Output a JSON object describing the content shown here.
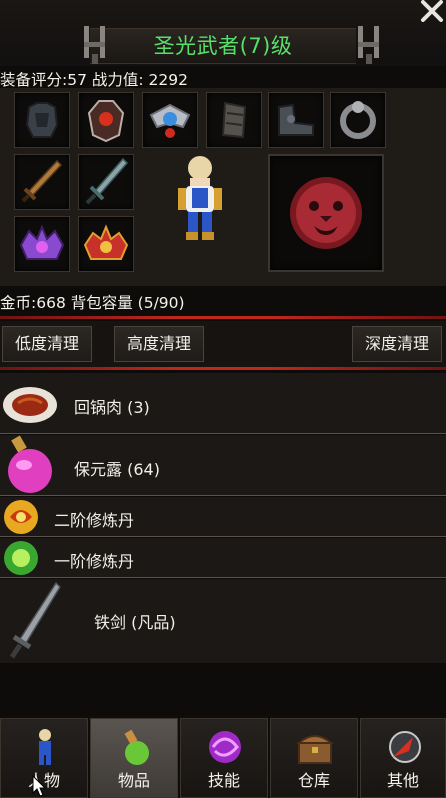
{
  "window": {
    "title": "圣光武者(7)级"
  },
  "stats": {
    "text": "装备评分:57 战力值: 2292"
  },
  "equipment": {
    "slots": [
      "chest-armor-icon",
      "shoulder-armor-icon",
      "amulet-icon",
      "bracer-icon",
      "boots-icon",
      "ring-icon",
      "bronze-sword-icon",
      "steel-sword-icon",
      "purple-crown-icon",
      "red-crown-icon"
    ],
    "portrait": "lion-emblem-icon",
    "character": "hero-figure"
  },
  "inventory": {
    "summary": "金币:668 背包容量 (5/90)"
  },
  "clean_buttons": {
    "low": "低度清理",
    "high": "高度清理",
    "deep": "深度清理"
  },
  "items": [
    {
      "name": "回锅肉 (3)",
      "icon": "meat-plate-icon"
    },
    {
      "name": "保元露 (64)",
      "icon": "potion-flask-icon"
    },
    {
      "name": "二阶修炼丹",
      "icon": "gold-pill-icon"
    },
    {
      "name": "一阶修炼丹",
      "icon": "green-pill-icon"
    },
    {
      "name": "铁剑 (凡品)",
      "icon": "iron-sword-icon"
    }
  ],
  "tabs": [
    {
      "label": "人物",
      "icon": "character-icon"
    },
    {
      "label": "物品",
      "icon": "bag-icon",
      "active": true
    },
    {
      "label": "技能",
      "icon": "skill-orb-icon"
    },
    {
      "label": "仓库",
      "icon": "chest-icon"
    },
    {
      "label": "其他",
      "icon": "compass-icon"
    }
  ],
  "colors": {
    "title": "#57e06a",
    "accent_line": "#c0281c",
    "background": "#0e0c0a"
  }
}
